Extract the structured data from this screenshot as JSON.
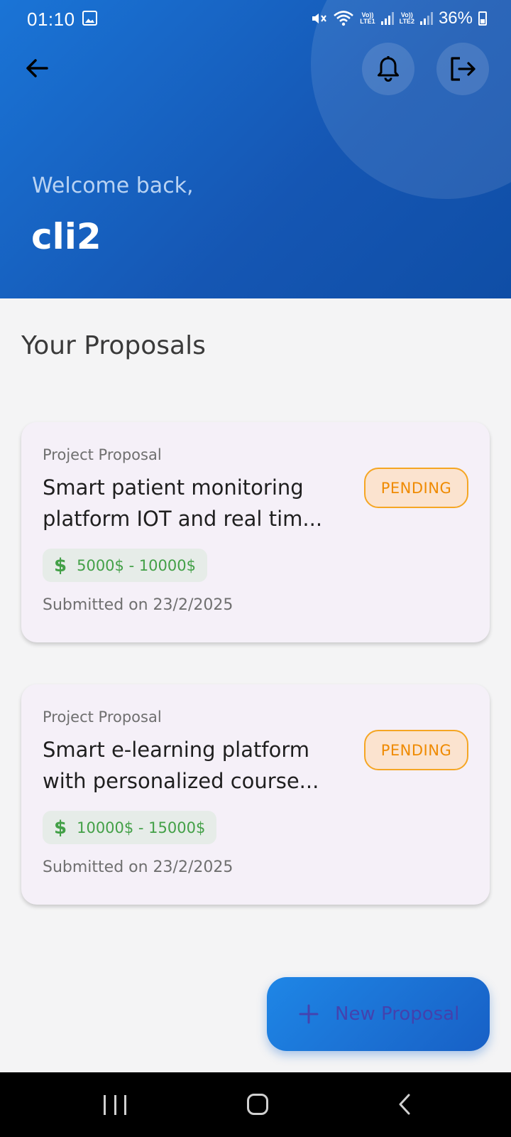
{
  "status_bar": {
    "time": "01:10",
    "lte1": "LTE1",
    "lte2": "LTE2",
    "volte": "Vo))",
    "battery": "36%"
  },
  "header": {
    "welcome": "Welcome back,",
    "username": "cli2"
  },
  "section_title": "Your Proposals",
  "proposals": [
    {
      "label": "Project Proposal",
      "title": "Smart patient monitoring platform IOT and real tim...",
      "status": "PENDING",
      "budget": "5000$ - 10000$",
      "submitted": "Submitted on 23/2/2025"
    },
    {
      "label": "Project Proposal",
      "title": "Smart e-learning platform with personalized course...",
      "status": "PENDING",
      "budget": "10000$ - 15000$",
      "submitted": "Submitted on 23/2/2025"
    }
  ],
  "fab": {
    "label": "New Proposal"
  },
  "icons": {
    "back": "arrow-left-icon",
    "bell": "bell-icon",
    "logout": "logout-icon",
    "plus": "plus-icon",
    "dollar": "$"
  },
  "colors": {
    "header_start": "#1a74d6",
    "header_end": "#0f4ea6",
    "pending_text": "#ef8a00",
    "pending_bg": "#fbe3cf",
    "budget_text": "#43a047"
  }
}
